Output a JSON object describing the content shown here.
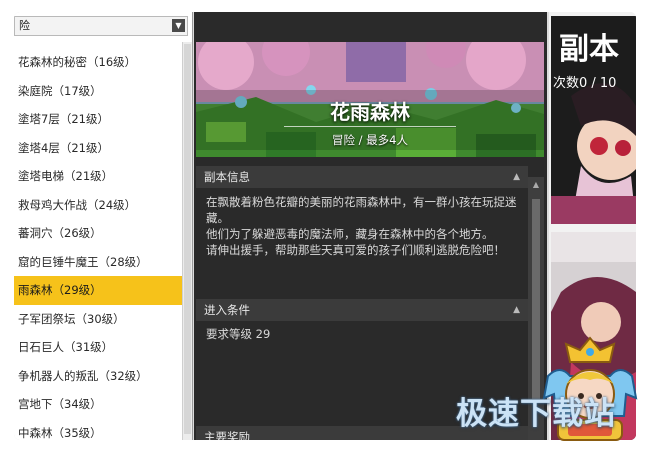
{
  "left_panel": {
    "category_select": {
      "value": "险"
    },
    "dungeons": [
      {
        "label": "花森林的秘密（16级）",
        "selected": false
      },
      {
        "label": "染庭院（17级）",
        "selected": false
      },
      {
        "label": "塗塔7层（21级）",
        "selected": false
      },
      {
        "label": "塗塔4层（21级）",
        "selected": false
      },
      {
        "label": "塗塔电梯（21级）",
        "selected": false
      },
      {
        "label": "救母鸡大作战（24级）",
        "selected": false
      },
      {
        "label": "蕃洞穴（26级）",
        "selected": false
      },
      {
        "label": "窟的巨锤牛魔王（28级）",
        "selected": false
      },
      {
        "label": "雨森林（29级）",
        "selected": true
      },
      {
        "label": "子军团祭坛（30级）",
        "selected": false
      },
      {
        "label": "日石巨人（31级）",
        "selected": false
      },
      {
        "label": "争机器人的叛乱（32级）",
        "selected": false
      },
      {
        "label": "宫地下（34级）",
        "selected": false
      },
      {
        "label": "中森林（35级）",
        "selected": false
      }
    ]
  },
  "detail": {
    "banner": {
      "title": "花雨森林",
      "subtitle": "冒险 / 最多4人"
    },
    "info_header": "副本信息",
    "info_text": [
      "在飘散着粉色花瓣的美丽的花雨森林中，有一群小孩在玩捉迷藏。",
      "他们为了躲避恶毒的魔法师，藏身在森林中的各个地方。",
      "请伸出援手，帮助那些天真可爱的孩子们顺利逃脱危险吧！"
    ],
    "requirement_header": "进入条件",
    "requirement_text": "要求等级 29",
    "reward_header": "主要奖励"
  },
  "right_panel": {
    "title": "副本",
    "count_text": "次数0 / 10"
  },
  "watermark": {
    "text": "极速下载站"
  },
  "colors": {
    "selected_row": "#f6c21a",
    "panel_dark": "#2a2a2a",
    "section_header": "#3b3b3b"
  }
}
